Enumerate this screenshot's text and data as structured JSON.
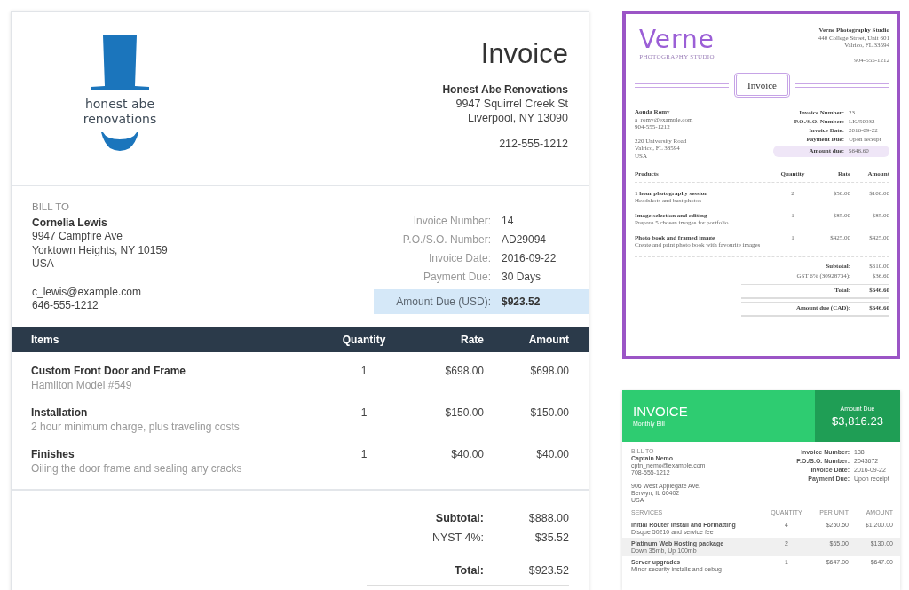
{
  "main_invoice": {
    "logo_text": [
      "honest abe",
      "renovations"
    ],
    "title": "Invoice",
    "company": "Honest Abe Renovations",
    "address": [
      "9947 Squirrel Creek St",
      "Liverpool, NY 13090"
    ],
    "phone": "212-555-1212",
    "bill_to_label": "BILL TO",
    "client": "Cornelia Lewis",
    "client_address": [
      "9947 Campfire Ave",
      "Yorktown Heights, NY 10159",
      "USA"
    ],
    "client_contact": [
      "c_lewis@example.com",
      "646-555-1212"
    ],
    "meta": [
      {
        "label": "Invoice Number:",
        "value": "14"
      },
      {
        "label": "P.O./S.O. Number:",
        "value": "AD29094"
      },
      {
        "label": "Invoice Date:",
        "value": "2016-09-22"
      },
      {
        "label": "Payment Due:",
        "value": "30 Days"
      }
    ],
    "amount_due": {
      "label": "Amount Due (USD):",
      "value": "$923.52"
    },
    "columns": [
      "Items",
      "Quantity",
      "Rate",
      "Amount"
    ],
    "rows": [
      {
        "name": "Custom Front Door and Frame",
        "detail": "Hamilton Model #549",
        "quantity": "1",
        "rate": "$698.00",
        "amount": "$698.00"
      },
      {
        "name": "Installation",
        "detail": "2 hour minimum charge, plus traveling costs",
        "quantity": "1",
        "rate": "$150.00",
        "amount": "$150.00"
      },
      {
        "name": "Finishes",
        "detail": "Oiling the door frame and sealing any cracks",
        "quantity": "1",
        "rate": "$40.00",
        "amount": "$40.00"
      }
    ],
    "totals": [
      {
        "label": "Subtotal:",
        "value": "$888.00",
        "kind": "bold"
      },
      {
        "label": "NYST 4%:",
        "value": "$35.52",
        "kind": "plain"
      },
      {
        "label": "Total:",
        "value": "$923.52",
        "kind": "total"
      }
    ]
  },
  "verne_invoice": {
    "logo": "Verne",
    "logo_sub": "PHOTOGRAPHY STUDIO",
    "company": "Verne Photography Studio",
    "address": [
      "440 College Street, Unit 601",
      "Valrico, FL 33594"
    ],
    "phone": "904-555-1212",
    "title": "Invoice",
    "client": "Aouda Romy",
    "client_contact": [
      "a_romy@example.com",
      "904-555-1212"
    ],
    "client_address": [
      "220 University Road",
      "Valrico, FL 33594",
      "USA"
    ],
    "meta": [
      {
        "label": "Invoice Number:",
        "value": "23"
      },
      {
        "label": "P.O./S.O. Number:",
        "value": "LKJ50932"
      },
      {
        "label": "Invoice Date:",
        "value": "2016-09-22"
      },
      {
        "label": "Payment Due:",
        "value": "Upon receipt"
      }
    ],
    "amount_due": {
      "label": "Amount due:",
      "value": "$646.60"
    },
    "columns": [
      "Products",
      "Quantity",
      "Rate",
      "Amount"
    ],
    "rows": [
      {
        "name": "1 hour photography session",
        "detail": "Headshots and bust photos",
        "quantity": "2",
        "rate": "$50.00",
        "amount": "$100.00"
      },
      {
        "name": "Image selection and editing",
        "detail": "Prepare 5 chosen images for portfolio",
        "quantity": "1",
        "rate": "$85.00",
        "amount": "$85.00"
      },
      {
        "name": "Photo book and framed image",
        "detail": "Create and print photo book with favourite images",
        "quantity": "1",
        "rate": "$425.00",
        "amount": "$425.00"
      }
    ],
    "totals": [
      {
        "label": "Subtotal:",
        "value": "$610.00",
        "kind": "bold"
      },
      {
        "label": "GST 6% (30928734):",
        "value": "$36.60",
        "kind": "plain"
      },
      {
        "label": "Total:",
        "value": "$646.60",
        "kind": "total"
      },
      {
        "label": "Amount due (CAD):",
        "value": "$646.60",
        "kind": "total"
      }
    ]
  },
  "green_invoice": {
    "title": "INVOICE",
    "subtitle": "Monthly Bill",
    "amount_due_label": "Amount Due",
    "amount_due": "$3,816.23",
    "bill_to_label": "BILL TO",
    "client": "Captain Nemo",
    "client_contact": [
      "cptn_nemo@example.com",
      "708-555-1212"
    ],
    "client_address": [
      "906 West Applegate Ave.",
      "Berwyn, IL 60402",
      "USA"
    ],
    "meta": [
      {
        "label": "Invoice Number:",
        "value": "138"
      },
      {
        "label": "P.O./S.O. Number:",
        "value": "2043672"
      },
      {
        "label": "Invoice Date:",
        "value": "2016-09-22"
      },
      {
        "label": "Payment Due:",
        "value": "Upon receipt"
      }
    ],
    "columns": [
      "SERVICES",
      "QUANTITY",
      "PER UNIT",
      "AMOUNT"
    ],
    "rows": [
      {
        "name": "Initial Router Install and Formatting",
        "detail": "Disque 50210 and service fee",
        "quantity": "4",
        "rate": "$250.50",
        "amount": "$1,200.00"
      },
      {
        "name": "Platinum Web Hosting package",
        "detail": "Down 35mb, Up 100mb",
        "quantity": "2",
        "rate": "$65.00",
        "amount": "$130.00"
      },
      {
        "name": "Server upgrades",
        "detail": "Minor security installs and debug",
        "quantity": "1",
        "rate": "$647.00",
        "amount": "$647.00"
      }
    ]
  }
}
